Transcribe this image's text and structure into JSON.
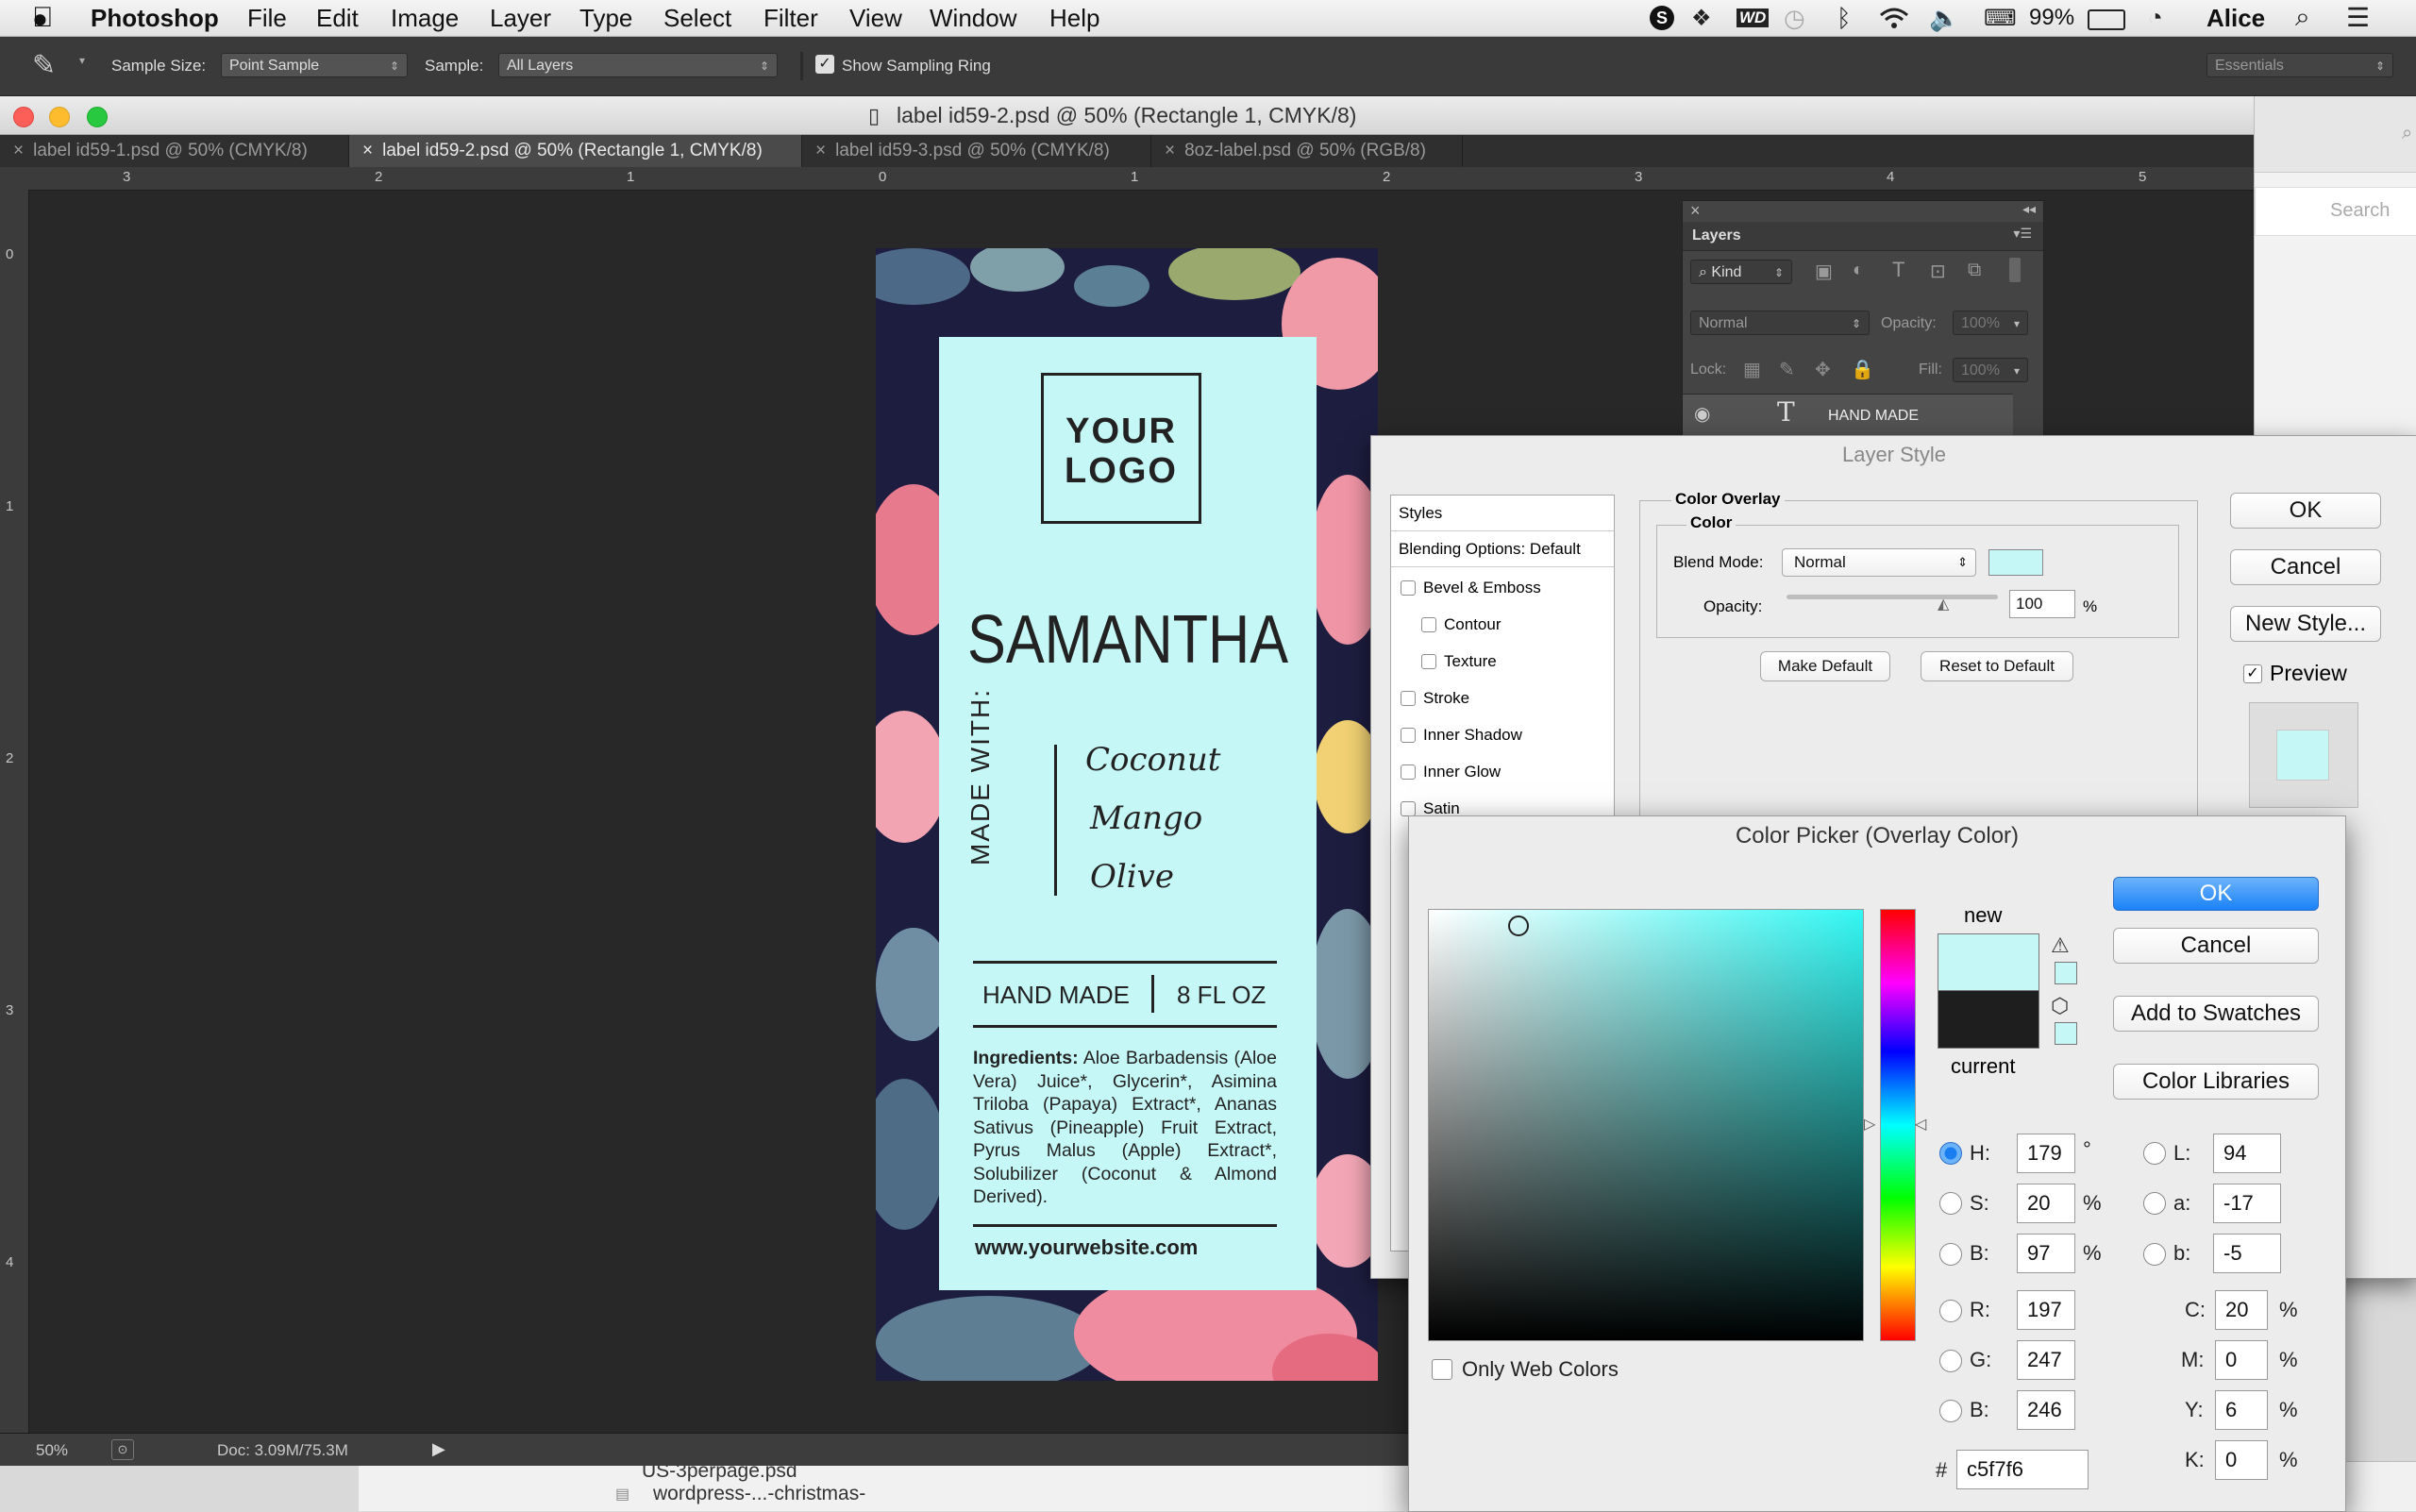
{
  "menubar": {
    "app": "Photoshop",
    "items": [
      "File",
      "Edit",
      "Image",
      "Layer",
      "Type",
      "Select",
      "Filter",
      "View",
      "Window",
      "Help"
    ],
    "battery": "99%",
    "user": "Alice",
    "wd_icon": "WD"
  },
  "options": {
    "sample_size_label": "Sample Size:",
    "sample_size_value": "Point Sample",
    "sample_label": "Sample:",
    "sample_value": "All Layers",
    "show_ring": "Show Sampling Ring",
    "workspace": "Essentials"
  },
  "document": {
    "title": "label id59-2.psd @ 50% (Rectangle 1, CMYK/8)",
    "tabs": [
      "label id59-1.psd @ 50% (CMYK/8)",
      "label id59-2.psd @ 50% (Rectangle 1, CMYK/8)",
      "label id59-3.psd @ 50% (CMYK/8)",
      "8oz-label.psd @ 50% (RGB/8)"
    ],
    "hruler": [
      "3",
      "2",
      "1",
      "0",
      "1",
      "2",
      "3",
      "4",
      "5"
    ],
    "vruler": [
      "0",
      "1",
      "2",
      "3",
      "4"
    ],
    "zoom": "50%",
    "doc_size": "Doc: 3.09M/75.3M"
  },
  "label": {
    "logo_line1": "YOUR",
    "logo_line2": "LOGO",
    "name": "SAMANTHA",
    "made_with": "MADE WITH:",
    "ingredients_script": [
      "Coconut",
      "Mango",
      "Olive"
    ],
    "hand_made": "HAND MADE",
    "volume": "8 FL OZ",
    "ingredients_title": "Ingredients:",
    "ingredients_text": "Aloe Barbadensis (Aloe Vera) Juice*, Glycerin*, Asimina Triloba (Papaya) Extract*, Ananas Sativus (Pineapple) Fruit Extract, Pyrus Malus (Apple) Extract*, Solubilizer (Coconut & Almond Derived).",
    "website": "www.yourwebsite.com"
  },
  "layers": {
    "title": "Layers",
    "kind": "Kind",
    "blend": "Normal",
    "opacity_label": "Opacity:",
    "opacity": "100%",
    "lock_label": "Lock:",
    "fill_label": "Fill:",
    "fill": "100%",
    "layer_name": "HAND MADE"
  },
  "layer_style": {
    "title": "Layer Style",
    "styles_header": "Styles",
    "blending_options": "Blending Options: Default",
    "styles": [
      "Bevel & Emboss",
      "Contour",
      "Texture",
      "Stroke",
      "Inner Shadow",
      "Inner Glow",
      "Satin"
    ],
    "section": "Color Overlay",
    "subsection": "Color",
    "blend_mode_label": "Blend Mode:",
    "blend_mode": "Normal",
    "opacity_label": "Opacity:",
    "opacity": "100",
    "percent": "%",
    "make_default": "Make Default",
    "reset_default": "Reset to Default",
    "ok": "OK",
    "cancel": "Cancel",
    "new_style": "New Style...",
    "preview": "Preview",
    "swatch_color": "#c5f7f6"
  },
  "color_picker": {
    "title": "Color Picker (Overlay Color)",
    "new_label": "new",
    "current_label": "current",
    "ok": "OK",
    "cancel": "Cancel",
    "add_swatches": "Add to Swatches",
    "libraries": "Color Libraries",
    "only_web": "Only Web Colors",
    "hsb": {
      "H": "179",
      "S": "20",
      "B": "97"
    },
    "rgb": {
      "R": "197",
      "G": "247",
      "B": "246"
    },
    "lab": {
      "L": "94",
      "a": "-17",
      "b": "-5"
    },
    "cmyk": {
      "C": "20",
      "M": "0",
      "Y": "6",
      "K": "0"
    },
    "hex": "c5f7f6",
    "hex_label": "#",
    "deg": "°",
    "percent": "%",
    "new_color": "#c5f7f6",
    "current_color": "#1e1e1e",
    "hue_color": "#33f7f3"
  },
  "finder": {
    "file1": "US-3perpage.psd",
    "file2": "wordpress-...-christmas-",
    "search": "Search"
  }
}
